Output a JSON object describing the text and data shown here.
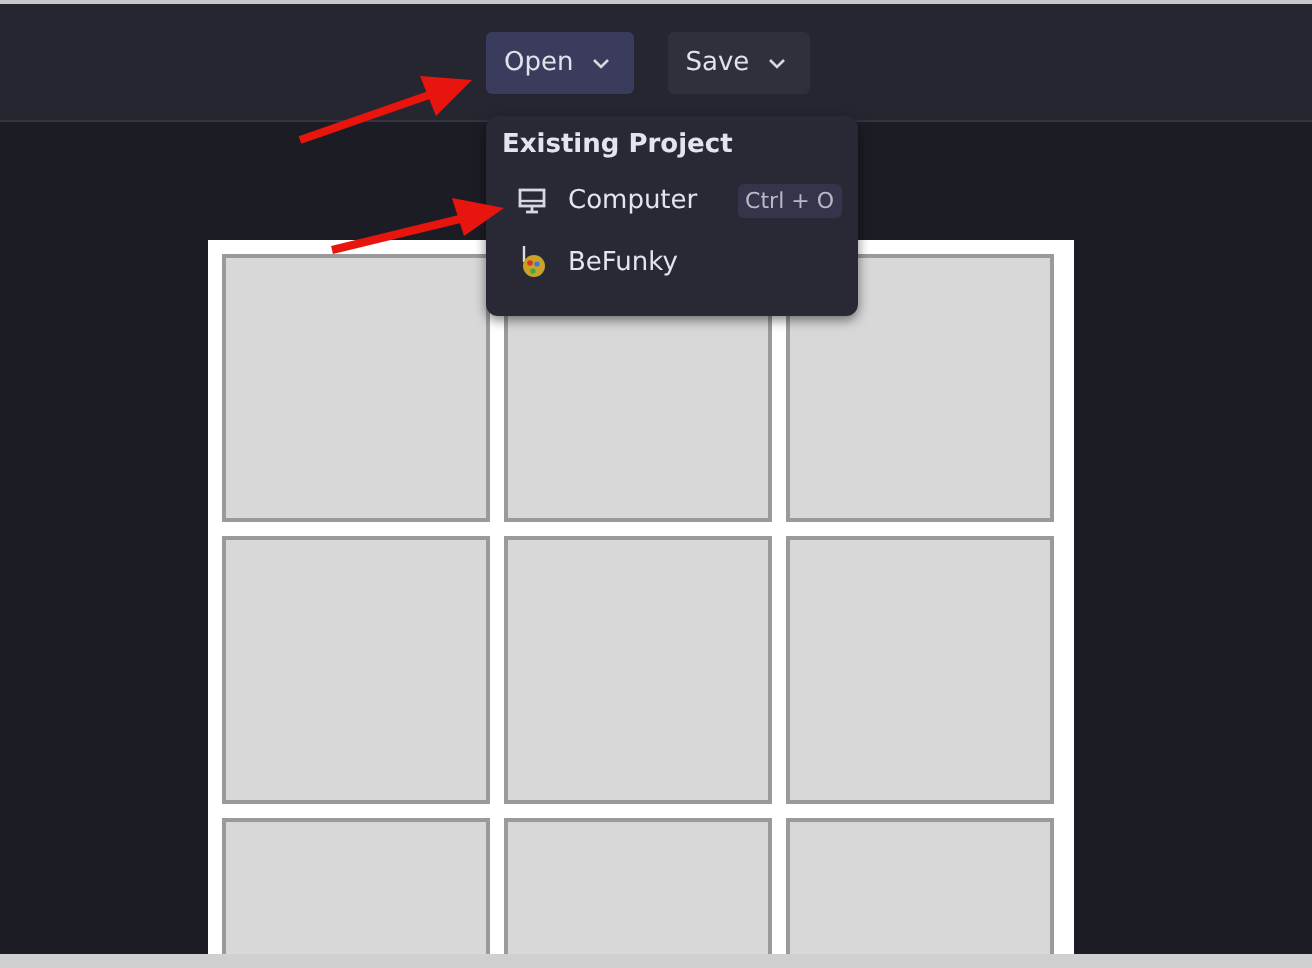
{
  "toolbar": {
    "buttons": [
      {
        "label": "Open",
        "selected": true
      },
      {
        "label": "Save",
        "selected": false
      }
    ]
  },
  "menu": {
    "title": "Existing Project",
    "items": [
      {
        "label": "Computer",
        "shortcut": "Ctrl + O",
        "kind": "computer"
      },
      {
        "label": "BeFunky",
        "kind": "befunky"
      }
    ]
  },
  "collage": {
    "slots": [
      {
        "kind": "empty"
      },
      {
        "kind": "empty"
      },
      {
        "kind": "empty"
      },
      {
        "kind": "empty"
      },
      {
        "kind": "empty"
      },
      {
        "kind": "empty"
      },
      {
        "kind": "empty"
      },
      {
        "kind": "empty"
      },
      {
        "kind": "empty"
      }
    ]
  }
}
